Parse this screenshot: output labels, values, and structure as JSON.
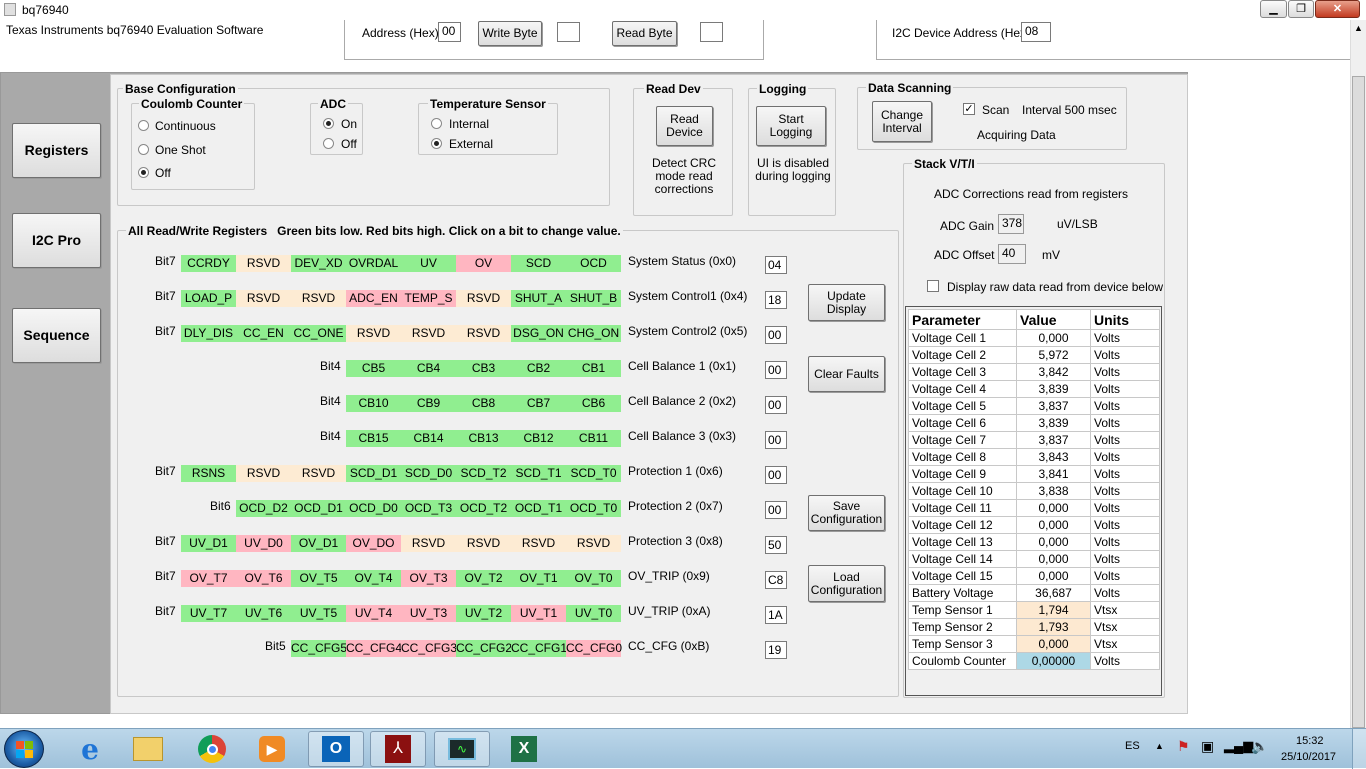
{
  "window": {
    "title": "bq76940",
    "subtitle": "Texas Instruments bq76940 Evaluation Software"
  },
  "top": {
    "address_label": "Address (Hex)",
    "address_value": "00",
    "write_byte": "Write Byte",
    "write_value": "",
    "read_byte": "Read Byte",
    "read_value": "",
    "i2c_addr_label": "I2C Device Address (Hex)",
    "i2c_addr_value": "08"
  },
  "nav": {
    "registers": "Registers",
    "i2c_pro": "I2C Pro",
    "sequence": "Sequence"
  },
  "base_config": {
    "title": "Base Configuration",
    "coulomb": {
      "title": "Coulomb Counter",
      "continuous": "Continuous",
      "one_shot": "One Shot",
      "off": "Off"
    },
    "adc": {
      "title": "ADC",
      "on": "On",
      "off": "Off"
    },
    "temp": {
      "title": "Temperature Sensor",
      "internal": "Internal",
      "external": "External"
    }
  },
  "read_dev": {
    "title": "Read Dev",
    "button": "Read Device",
    "note": "Detect CRC mode read corrections"
  },
  "logging": {
    "title": "Logging",
    "button": "Start Logging",
    "note": "UI is disabled during logging"
  },
  "scanning": {
    "title": "Data Scanning",
    "button": "Change Interval",
    "scan": "Scan",
    "interval": "Interval 500 msec",
    "status": "Acquiring Data"
  },
  "registers": {
    "title": "All Read/Write Registers   Green bits low. Red bits high. Click on a bit to change value.",
    "rows": [
      {
        "bitlbl": "Bit7",
        "bits": [
          [
            "CCRDY",
            "g"
          ],
          [
            "RSVD",
            "t"
          ],
          [
            "DEV_XD",
            "g"
          ],
          [
            "OVRDAL",
            "g"
          ],
          [
            "UV",
            "g"
          ],
          [
            "OV",
            "r"
          ],
          [
            "SCD",
            "g"
          ],
          [
            "OCD",
            "g"
          ]
        ],
        "name": "System Status (0x0)",
        "hex": "04"
      },
      {
        "bitlbl": "Bit7",
        "bits": [
          [
            "LOAD_P",
            "g"
          ],
          [
            "RSVD",
            "t"
          ],
          [
            "RSVD",
            "t"
          ],
          [
            "ADC_EN",
            "r"
          ],
          [
            "TEMP_S",
            "r"
          ],
          [
            "RSVD",
            "t"
          ],
          [
            "SHUT_A",
            "g"
          ],
          [
            "SHUT_B",
            "g"
          ]
        ],
        "name": "System Control1 (0x4)",
        "hex": "18"
      },
      {
        "bitlbl": "Bit7",
        "bits": [
          [
            "DLY_DIS",
            "g"
          ],
          [
            "CC_EN",
            "g"
          ],
          [
            "CC_ONE",
            "g"
          ],
          [
            "RSVD",
            "t"
          ],
          [
            "RSVD",
            "t"
          ],
          [
            "RSVD",
            "t"
          ],
          [
            "DSG_ON",
            "g"
          ],
          [
            "CHG_ON",
            "g"
          ]
        ],
        "name": "System Control2 (0x5)",
        "hex": "00"
      },
      {
        "bitlbl": "Bit4",
        "bits": [
          [
            "CB5",
            "g"
          ],
          [
            "CB4",
            "g"
          ],
          [
            "CB3",
            "g"
          ],
          [
            "CB2",
            "g"
          ],
          [
            "CB1",
            "g"
          ]
        ],
        "name": "Cell Balance 1 (0x1)",
        "hex": "00"
      },
      {
        "bitlbl": "Bit4",
        "bits": [
          [
            "CB10",
            "g"
          ],
          [
            "CB9",
            "g"
          ],
          [
            "CB8",
            "g"
          ],
          [
            "CB7",
            "g"
          ],
          [
            "CB6",
            "g"
          ]
        ],
        "name": "Cell Balance 2 (0x2)",
        "hex": "00"
      },
      {
        "bitlbl": "Bit4",
        "bits": [
          [
            "CB15",
            "g"
          ],
          [
            "CB14",
            "g"
          ],
          [
            "CB13",
            "g"
          ],
          [
            "CB12",
            "g"
          ],
          [
            "CB11",
            "g"
          ]
        ],
        "name": "Cell Balance 3 (0x3)",
        "hex": "00"
      },
      {
        "bitlbl": "Bit7",
        "bits": [
          [
            "RSNS",
            "g"
          ],
          [
            "RSVD",
            "t"
          ],
          [
            "RSVD",
            "t"
          ],
          [
            "SCD_D1",
            "g"
          ],
          [
            "SCD_D0",
            "g"
          ],
          [
            "SCD_T2",
            "g"
          ],
          [
            "SCD_T1",
            "g"
          ],
          [
            "SCD_T0",
            "g"
          ]
        ],
        "name": "Protection 1 (0x6)",
        "hex": "00"
      },
      {
        "bitlbl": "Bit6",
        "bits": [
          [
            "OCD_D2",
            "g"
          ],
          [
            "OCD_D1",
            "g"
          ],
          [
            "OCD_D0",
            "g"
          ],
          [
            "OCD_T3",
            "g"
          ],
          [
            "OCD_T2",
            "g"
          ],
          [
            "OCD_T1",
            "g"
          ],
          [
            "OCD_T0",
            "g"
          ]
        ],
        "name": "Protection 2 (0x7)",
        "hex": "00"
      },
      {
        "bitlbl": "Bit7",
        "bits": [
          [
            "UV_D1",
            "g"
          ],
          [
            "UV_D0",
            "r"
          ],
          [
            "OV_D1",
            "g"
          ],
          [
            "OV_DO",
            "r"
          ],
          [
            "RSVD",
            "t"
          ],
          [
            "RSVD",
            "t"
          ],
          [
            "RSVD",
            "t"
          ],
          [
            "RSVD",
            "t"
          ]
        ],
        "name": "Protection 3 (0x8)",
        "hex": "50"
      },
      {
        "bitlbl": "Bit7",
        "bits": [
          [
            "OV_T7",
            "r"
          ],
          [
            "OV_T6",
            "r"
          ],
          [
            "OV_T5",
            "g"
          ],
          [
            "OV_T4",
            "g"
          ],
          [
            "OV_T3",
            "r"
          ],
          [
            "OV_T2",
            "g"
          ],
          [
            "OV_T1",
            "g"
          ],
          [
            "OV_T0",
            "g"
          ]
        ],
        "name": "OV_TRIP (0x9)",
        "hex": "C8"
      },
      {
        "bitlbl": "Bit7",
        "bits": [
          [
            "UV_T7",
            "g"
          ],
          [
            "UV_T6",
            "g"
          ],
          [
            "UV_T5",
            "g"
          ],
          [
            "UV_T4",
            "r"
          ],
          [
            "UV_T3",
            "r"
          ],
          [
            "UV_T2",
            "g"
          ],
          [
            "UV_T1",
            "r"
          ],
          [
            "UV_T0",
            "g"
          ]
        ],
        "name": "UV_TRIP (0xA)",
        "hex": "1A"
      },
      {
        "bitlbl": "Bit5",
        "bits": [
          [
            "CC_CFG5",
            "g"
          ],
          [
            "CC_CFG4",
            "r"
          ],
          [
            "CC_CFG3",
            "r"
          ],
          [
            "CC_CFG2",
            "g"
          ],
          [
            "CC_CFG1",
            "g"
          ],
          [
            "CC_CFG0",
            "r"
          ]
        ],
        "name": "CC_CFG (0xB)",
        "hex": "19"
      }
    ],
    "buttons": {
      "update": "Update Display",
      "clear": "Clear Faults",
      "save": "Save Configuration",
      "load": "Load Configuration"
    }
  },
  "stack": {
    "title": "Stack V/T/I",
    "note": "ADC Corrections read from registers",
    "gain_label": "ADC Gain",
    "gain_value": "378",
    "gain_unit": "uV/LSB",
    "offset_label": "ADC Offset",
    "offset_value": "40",
    "offset_unit": "mV",
    "raw_label": "Display raw data read from device below",
    "headers": [
      "Parameter",
      "Value",
      "Units"
    ],
    "rows": [
      [
        "Voltage Cell 1",
        "0,000",
        "Volts",
        ""
      ],
      [
        "Voltage Cell 2",
        "5,972",
        "Volts",
        ""
      ],
      [
        "Voltage Cell 3",
        "3,842",
        "Volts",
        ""
      ],
      [
        "Voltage Cell 4",
        "3,839",
        "Volts",
        ""
      ],
      [
        "Voltage Cell 5",
        "3,837",
        "Volts",
        ""
      ],
      [
        "Voltage Cell 6",
        "3,839",
        "Volts",
        ""
      ],
      [
        "Voltage Cell 7",
        "3,837",
        "Volts",
        ""
      ],
      [
        "Voltage Cell 8",
        "3,843",
        "Volts",
        ""
      ],
      [
        "Voltage Cell 9",
        "3,841",
        "Volts",
        ""
      ],
      [
        "Voltage Cell 10",
        "3,838",
        "Volts",
        ""
      ],
      [
        "Voltage Cell 11",
        "0,000",
        "Volts",
        ""
      ],
      [
        "Voltage Cell 12",
        "0,000",
        "Volts",
        ""
      ],
      [
        "Voltage Cell 13",
        "0,000",
        "Volts",
        ""
      ],
      [
        "Voltage Cell 14",
        "0,000",
        "Volts",
        ""
      ],
      [
        "Voltage Cell 15",
        "0,000",
        "Volts",
        ""
      ],
      [
        "Battery Voltage",
        "36,687",
        "Volts",
        ""
      ],
      [
        "Temp Sensor 1",
        "1,794",
        "Vtsx",
        "orange"
      ],
      [
        "Temp Sensor 2",
        "1,793",
        "Vtsx",
        "orange"
      ],
      [
        "Temp Sensor 3",
        "0,000",
        "Vtsx",
        "orange"
      ],
      [
        "Coulomb Counter",
        "0,00000",
        "Volts",
        "blue"
      ]
    ]
  },
  "taskbar": {
    "lang": "ES",
    "time": "15:32",
    "date": "25/10/2017"
  }
}
